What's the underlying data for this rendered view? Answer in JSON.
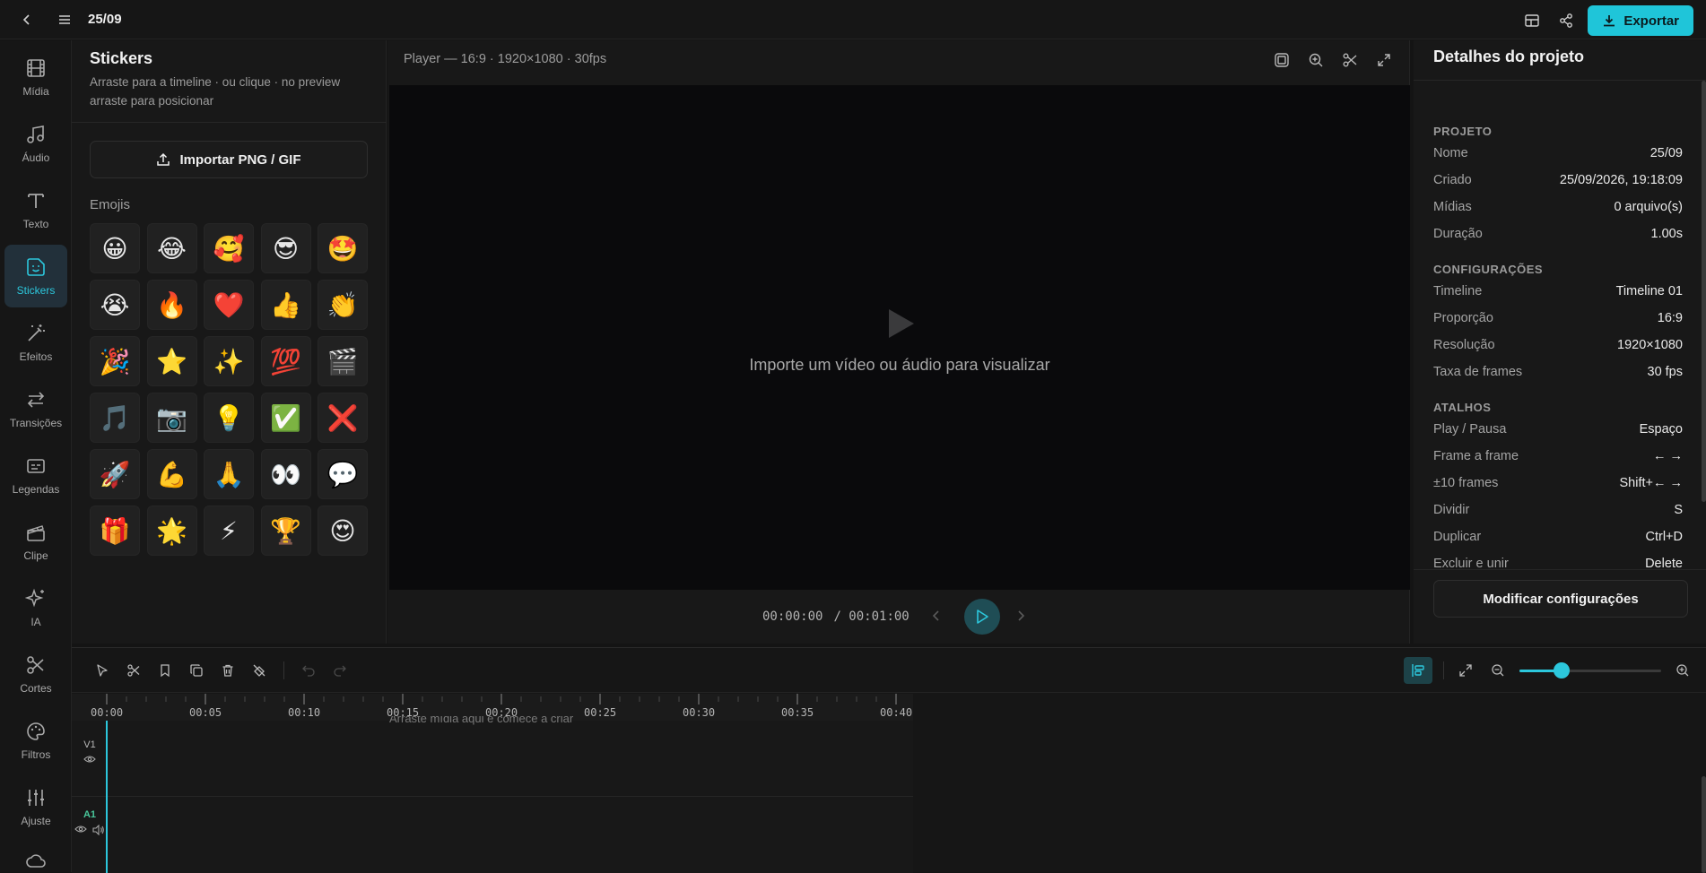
{
  "app": {
    "project_title": "25/09"
  },
  "topbar": {
    "export_label": "Exportar"
  },
  "rail": {
    "items": [
      {
        "label": "Mídia"
      },
      {
        "label": "Áudio"
      },
      {
        "label": "Texto"
      },
      {
        "label": "Stickers"
      },
      {
        "label": "Efeitos"
      },
      {
        "label": "Transições"
      },
      {
        "label": "Legendas"
      },
      {
        "label": "Clipe"
      },
      {
        "label": "IA"
      },
      {
        "label": "Cortes"
      },
      {
        "label": "Filtros"
      },
      {
        "label": "Ajuste"
      }
    ],
    "active": "Stickers"
  },
  "stickers": {
    "title": "Stickers",
    "subtitle": "Arraste para a timeline · ou clique · no preview arraste para posicionar",
    "import_label": "Importar PNG / GIF",
    "section_label": "Emojis",
    "emojis": [
      "😀",
      "😂",
      "🥰",
      "😎",
      "🤩",
      "😭",
      "🔥",
      "❤️",
      "👍",
      "👏",
      "🎉",
      "⭐",
      "✨",
      "💯",
      "🎬",
      "🎵",
      "📷",
      "💡",
      "✅",
      "❌",
      "🚀",
      "💪",
      "🙏",
      "👀",
      "💬",
      "🎁",
      "🌟",
      "⚡",
      "🏆",
      "😍"
    ]
  },
  "player": {
    "header": "Player — 16:9 · 1920×1080 · 30fps",
    "empty_message": "Importe um vídeo ou áudio para visualizar",
    "current_time": "00:00:00",
    "total_time": "/ 00:01:00"
  },
  "details": {
    "title": "Detalhes do projeto",
    "projeto_label": "PROJETO",
    "projeto": [
      {
        "k": "Nome",
        "v": "25/09"
      },
      {
        "k": "Criado",
        "v": "25/09/2026, 19:18:09"
      },
      {
        "k": "Mídias",
        "v": "0 arquivo(s)"
      },
      {
        "k": "Duração",
        "v": "1.00s"
      }
    ],
    "config_label": "CONFIGURAÇÕES",
    "config": [
      {
        "k": "Timeline",
        "v": "Timeline 01"
      },
      {
        "k": "Proporção",
        "v": "16:9"
      },
      {
        "k": "Resolução",
        "v": "1920×1080"
      },
      {
        "k": "Taxa de frames",
        "v": "30 fps"
      }
    ],
    "atalhos_label": "ATALHOS",
    "atalhos": [
      {
        "k": "Play / Pausa",
        "v": "Espaço"
      },
      {
        "k": "Frame a frame",
        "v": "← →"
      },
      {
        "k": "±10 frames",
        "v": "Shift+← →"
      },
      {
        "k": "Dividir",
        "v": "S"
      },
      {
        "k": "Duplicar",
        "v": "Ctrl+D"
      },
      {
        "k": "Excluir e unir",
        "v": "Delete"
      }
    ],
    "modify_label": "Modificar configurações"
  },
  "timeline": {
    "ruler_labels": [
      "00:00",
      "00:05",
      "00:10",
      "00:15",
      "00:20",
      "00:25",
      "00:30",
      "00:35",
      "00:40"
    ],
    "drop_hint": "Arraste mídia aqui e comece a criar",
    "tracks": [
      "V1",
      "A1"
    ],
    "zoom_level": 0.3
  },
  "colors": {
    "accent": "#2cc7dc",
    "export_bg": "#1fc5d9",
    "audio_track": "#49c79b"
  }
}
